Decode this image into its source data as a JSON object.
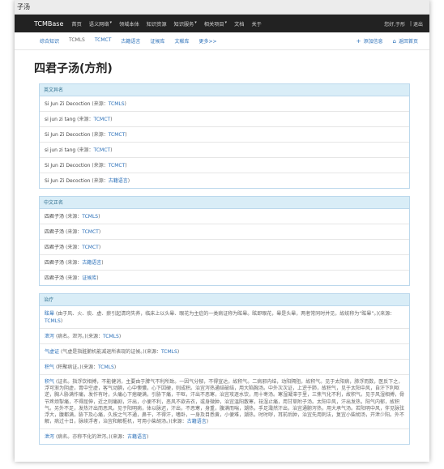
{
  "window": {
    "title": "子汤"
  },
  "navbar": {
    "brand": "TCMBase",
    "items": [
      "首页",
      "语义网络",
      "领域本体",
      "知识资源",
      "知识服务",
      "相关项目",
      "文档",
      "关于"
    ],
    "dropdown_items": [
      false,
      true,
      false,
      false,
      true,
      true,
      false,
      false
    ],
    "user_text": "您好,于彤",
    "user_sep": "|",
    "logout": "退出"
  },
  "subnav": {
    "items": [
      "综合知识",
      "TCMLS",
      "TCMCT",
      "古籍语言",
      "证候库",
      "文献库",
      "更多>>"
    ],
    "add_label": "添加信息",
    "home_label": "返回首页"
  },
  "page": {
    "title": "四君子汤(方剂)"
  },
  "english_names": {
    "header": "英文异名",
    "rows": [
      {
        "text": "Si Jun Zi Decoction",
        "source": "TCMLS"
      },
      {
        "text": "si jun zi tang",
        "source": "TCMCT"
      },
      {
        "text": "Si Jun Zi Decoction",
        "source": "TCMCT"
      },
      {
        "text": "si jun zi tang",
        "source": "TCMCT"
      },
      {
        "text": "Si Jun Zi Decoction",
        "source": "TCMCT"
      },
      {
        "text": "Si Jun Zi Decoction",
        "source": "古籍语言"
      }
    ]
  },
  "chinese_names": {
    "header": "中文正名",
    "rows": [
      {
        "text": "四君子汤",
        "source": "TCMLS"
      },
      {
        "text": "四君子汤",
        "source": "TCMCT"
      },
      {
        "text": "四君子汤",
        "source": "TCMCT"
      },
      {
        "text": "四君子汤",
        "source": "古籍语言"
      },
      {
        "text": "四君子汤",
        "source": "证候库"
      }
    ]
  },
  "treatment": {
    "header": "治疗",
    "rows": [
      {
        "term": "眩晕",
        "desc": "(由于风、火、痰、虚、瘀引起清窍失养，临床上以头晕、眼花为主症的一类病证称为眩晕。眩即眼花，晕是头晕，两者常同时并见，故统称为“眩晕”。)",
        "source": "TCMLS"
      },
      {
        "term": "泄泻",
        "desc": "(病名。泄泻。)",
        "source": "TCMLS"
      },
      {
        "term": "气虚证",
        "desc": "(气虚是指脏腑机能减退所表现的证候。)",
        "source": "TCMLS"
      },
      {
        "term": "积气",
        "desc": "(积聚病证。)",
        "source": "TCMLS"
      },
      {
        "term": "积气",
        "desc": "(证名。指浮饮相搏，不能健消，主要由于脾气不利所致。一因气分郁，不得宣达，故积气。二病邪内结，动阳隔阻，故积气。见于太阳病，肺浮而数，医反下之，浮可渐为阴虚，胃中空虚，客气动膈，心中懊憹，心下因硬，则成积。治宜泻热通结破结，用大陷胸汤。中外次次证，上逆于肺，故积气，见于太阳中风，自汗下利呕逆，胸人胁满作痛，发作有时，头痛心下痞硬满，引胁下痛，干呕，汗出不恶寒，治宜攻逐水饮，用十枣汤。寒湿凝滞于里，三焦气化不利，故积气。见于风湿相搏，骨节疼烦掣痛，不得屈伸，近之则痛剧，汗出，小便不利，恶风不欲去衣，或身微肿，治宜温阳散寒，祛湿止痛，用甘草附子汤。太阳中风，汗出发热，阳气内郁，故积气。另外不足，发热汗出而恶风。见于阳明病，体以脉迟，汗出，不恶寒，身重，腹满而喘，潮热，手足濈然汗出，治宜通腑泻热，用大承气汤。若阳明中风，伴见脉弦浮大，腹都满，胁下及心痛，久按之气不通，鼻干，不得汗，嗜卧，一身及目悉黄，小便难，潮热，时时哕，耳前后肿，治宜先用刺法，复宜小柴胡汤，开泄少阳。外不解，病过十日，脉续浮者，治宜和解枢机，可用小柴胡汤。)",
        "source": "古籍语言"
      },
      {
        "term": "泄泻",
        "desc": "(病名。亦称不化的泄泻。)",
        "source": "古籍语言"
      }
    ]
  },
  "labels": {
    "source_prefix": "(来源：",
    "source_suffix": ")"
  },
  "colors": {
    "navbar_bg": "#222222",
    "link": "#2a6fb8",
    "panel_head_bg": "#d9edf7",
    "panel_head_text": "#31708f",
    "panel_border": "#bcd8ec"
  },
  "icons": {
    "add": "plus-icon",
    "home": "home-icon",
    "dropdown": "caret-down-icon"
  }
}
